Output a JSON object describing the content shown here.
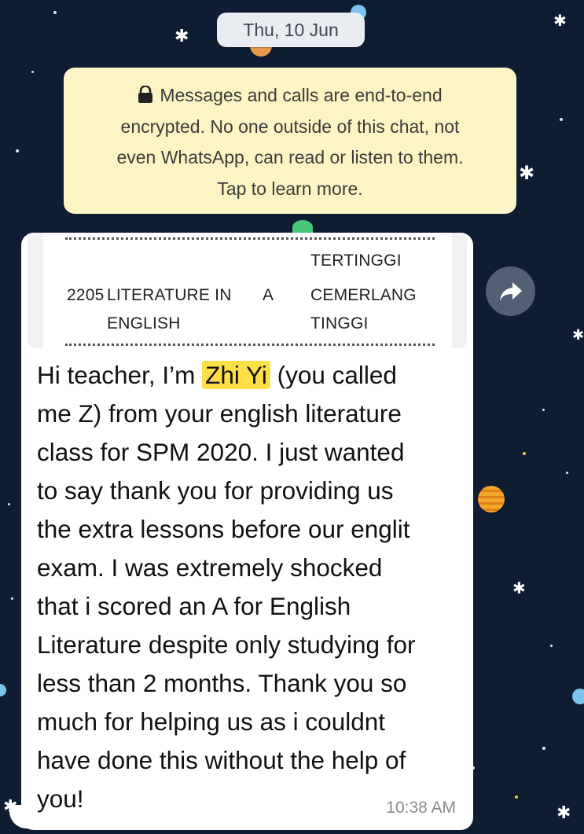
{
  "date_label": "Thu, 10 Jun",
  "encryption_notice": {
    "icon": "lock-icon",
    "line1": "Messages and calls are end-to-end",
    "line2": "encrypted. No one outside of this chat, not",
    "line3": "even WhatsApp, can read or listen to them.",
    "line4": "Tap to learn more."
  },
  "quoted_image": {
    "row1": {
      "code": "",
      "subject": "",
      "grade": "",
      "desc1": "",
      "desc2": "TERTINGGI"
    },
    "row2": {
      "code": "2205",
      "subject1": "LITERATURE IN",
      "subject2": "ENGLISH",
      "grade": "A",
      "desc1": "CEMERLANG",
      "desc2": "TINGGI"
    }
  },
  "message": {
    "before_name": "Hi teacher, I’m ",
    "name": "Zhi Yi",
    "line1_rest": " (you called",
    "line2": "me Z) from your english literature",
    "line3": "class for SPM 2020. I just wanted",
    "line4": "to say thank you for providing us",
    "line5": "the extra lessons before our englit",
    "line6": "exam. I was extremely shocked",
    "line7": "that i scored an A for English",
    "line8": "Literature despite only studying for",
    "line9": "less than 2 months. Thank you so",
    "line10": "much for helping us as i couldnt",
    "line11": "have done this without the help of",
    "line12": "you!",
    "time": "10:38 AM"
  },
  "forward_icon": "forward-arrow-icon",
  "colors": {
    "wallpaper": "#0f1d33",
    "notice": "#fdf4c5",
    "highlight": "#fde047",
    "bubble": "#ffffff"
  }
}
